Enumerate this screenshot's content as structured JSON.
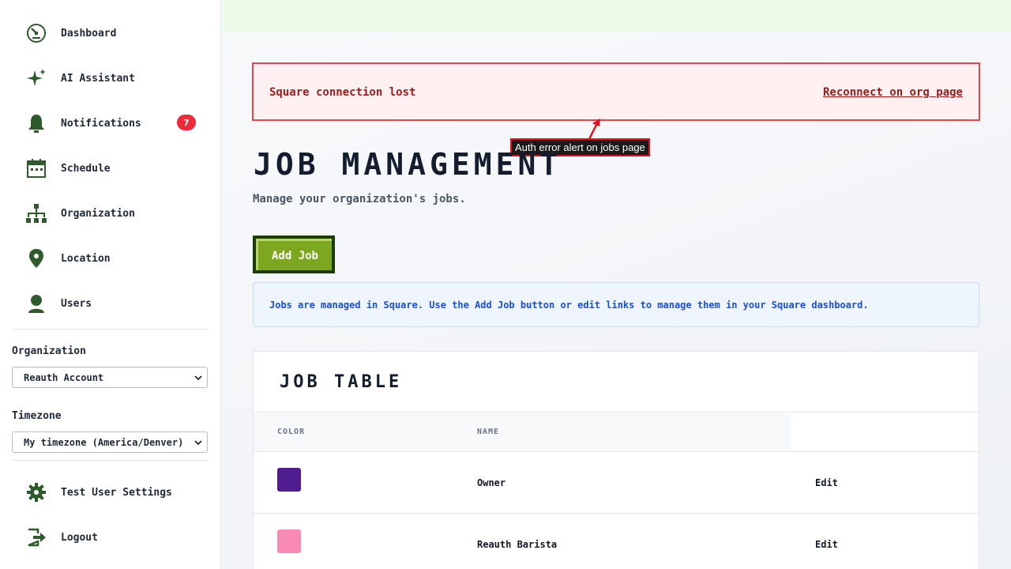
{
  "sidebar": {
    "items": [
      {
        "label": "Dashboard",
        "icon": "dashboard-icon"
      },
      {
        "label": "AI Assistant",
        "icon": "sparkle-icon"
      },
      {
        "label": "Notifications",
        "icon": "bell-icon",
        "badge": "7"
      },
      {
        "label": "Schedule",
        "icon": "calendar-icon"
      },
      {
        "label": "Organization",
        "icon": "org-chart-icon"
      },
      {
        "label": "Location",
        "icon": "location-pin-icon"
      },
      {
        "label": "Users",
        "icon": "user-icon"
      }
    ],
    "organization": {
      "label": "Organization",
      "value": "Reauth Account"
    },
    "timezone": {
      "label": "Timezone",
      "value": "My timezone (America/Denver)"
    },
    "footer_items": [
      {
        "label": "Test User Settings",
        "icon": "gear-icon"
      },
      {
        "label": "Logout",
        "icon": "logout-icon"
      }
    ]
  },
  "alert": {
    "message": "Square connection lost",
    "link": "Reconnect on org page",
    "annotation": "Auth error alert on jobs page"
  },
  "page": {
    "title": "JOB MANAGEMENT",
    "subtitle": "Manage your organization's jobs.",
    "add_button": "Add Job",
    "info": "Jobs are managed in Square. Use the Add Job button or edit links to manage them in your Square dashboard."
  },
  "table": {
    "title": "JOB TABLE",
    "columns": [
      "COLOR",
      "NAME"
    ],
    "rows": [
      {
        "color": "#4f1d8f",
        "name": "Owner",
        "action": "Edit"
      },
      {
        "color": "#f78bb5",
        "name": "Reauth Barista",
        "action": "Edit"
      }
    ]
  },
  "colors": {
    "accent_green": "#7da71e",
    "alert_red": "#e0474f",
    "badge_red": "#ef2a3a",
    "icon_green": "#2f5a2c"
  }
}
